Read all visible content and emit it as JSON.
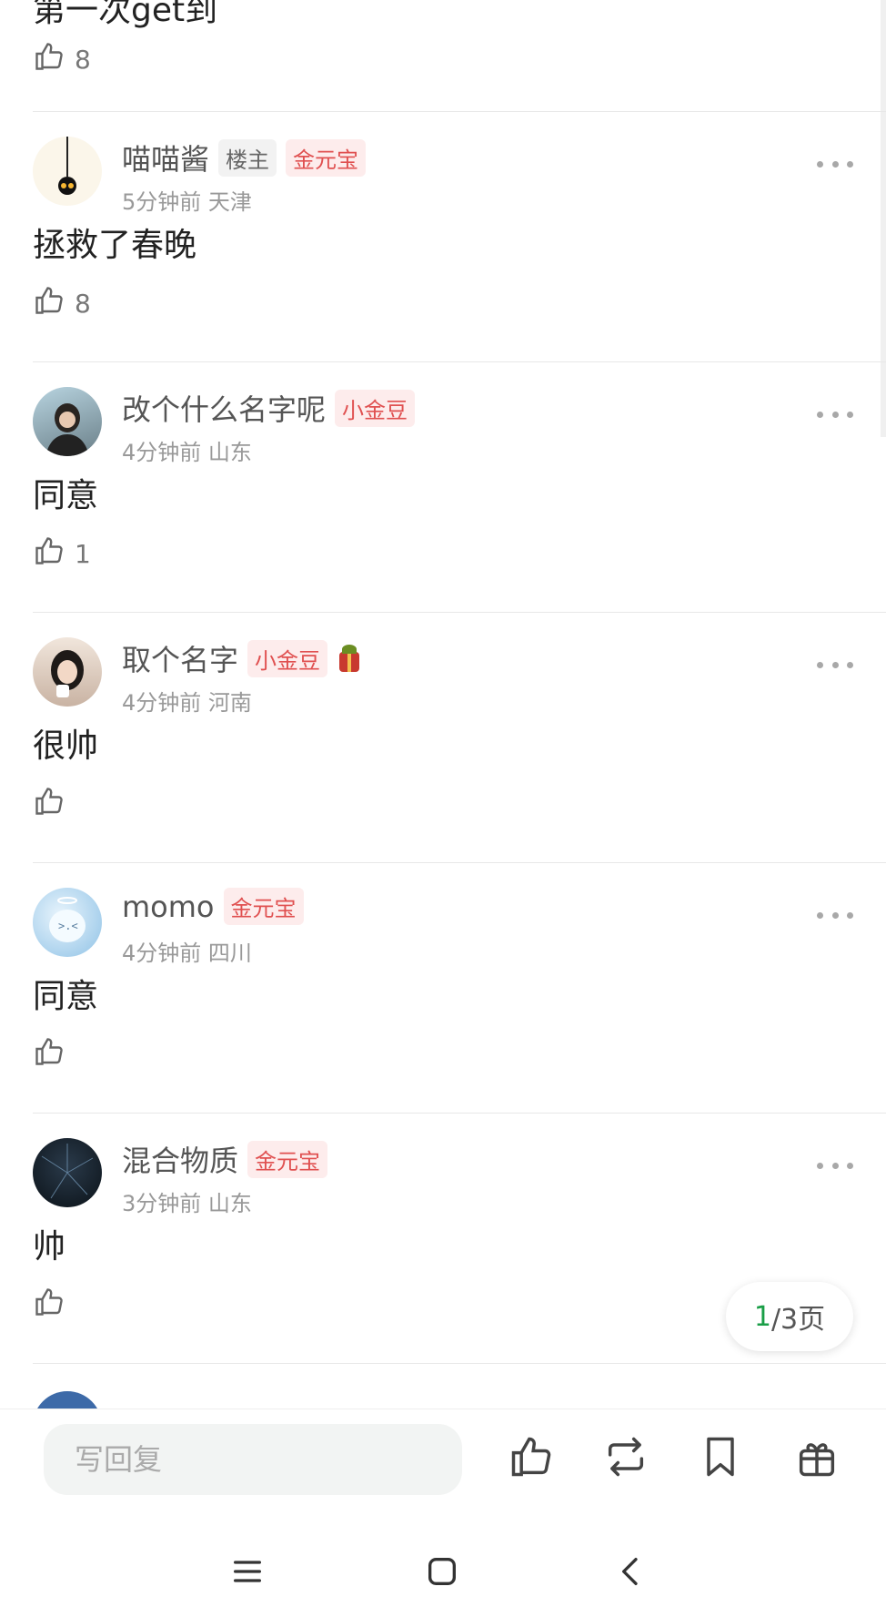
{
  "partial_top": {
    "text": "第一次get到",
    "likes": "8"
  },
  "comments": [
    {
      "name": "喵喵酱",
      "tags": [
        "楼主",
        "金元宝"
      ],
      "meta": "5分钟前 天津",
      "content": "拯救了春晚",
      "likes": "8"
    },
    {
      "name": "改个什么名字呢",
      "tags": [
        "小金豆"
      ],
      "meta": "4分钟前 山东",
      "content": "同意",
      "likes": "1"
    },
    {
      "name": "取个名字",
      "tags": [
        "小金豆"
      ],
      "meta": "4分钟前 河南",
      "content": "很帅",
      "likes": ""
    },
    {
      "name": "momo",
      "tags": [
        "金元宝"
      ],
      "meta": "4分钟前 四川",
      "content": "同意",
      "likes": ""
    },
    {
      "name": "混合物质",
      "tags": [
        "金元宝"
      ],
      "meta": "3分钟前 山东",
      "content": "帅",
      "likes": ""
    }
  ],
  "page_indicator": {
    "current": "1",
    "total": "/3页"
  },
  "reply_bar": {
    "placeholder": "写回复"
  },
  "icons": {
    "like": "thumbs-up-icon",
    "repost": "repost-icon",
    "bookmark": "bookmark-icon",
    "gift": "gift-icon",
    "menu": "menu-icon",
    "home": "home-icon",
    "back": "back-icon"
  },
  "colors": {
    "accent_green": "#1a9e47",
    "tag_red": "#e05050"
  }
}
